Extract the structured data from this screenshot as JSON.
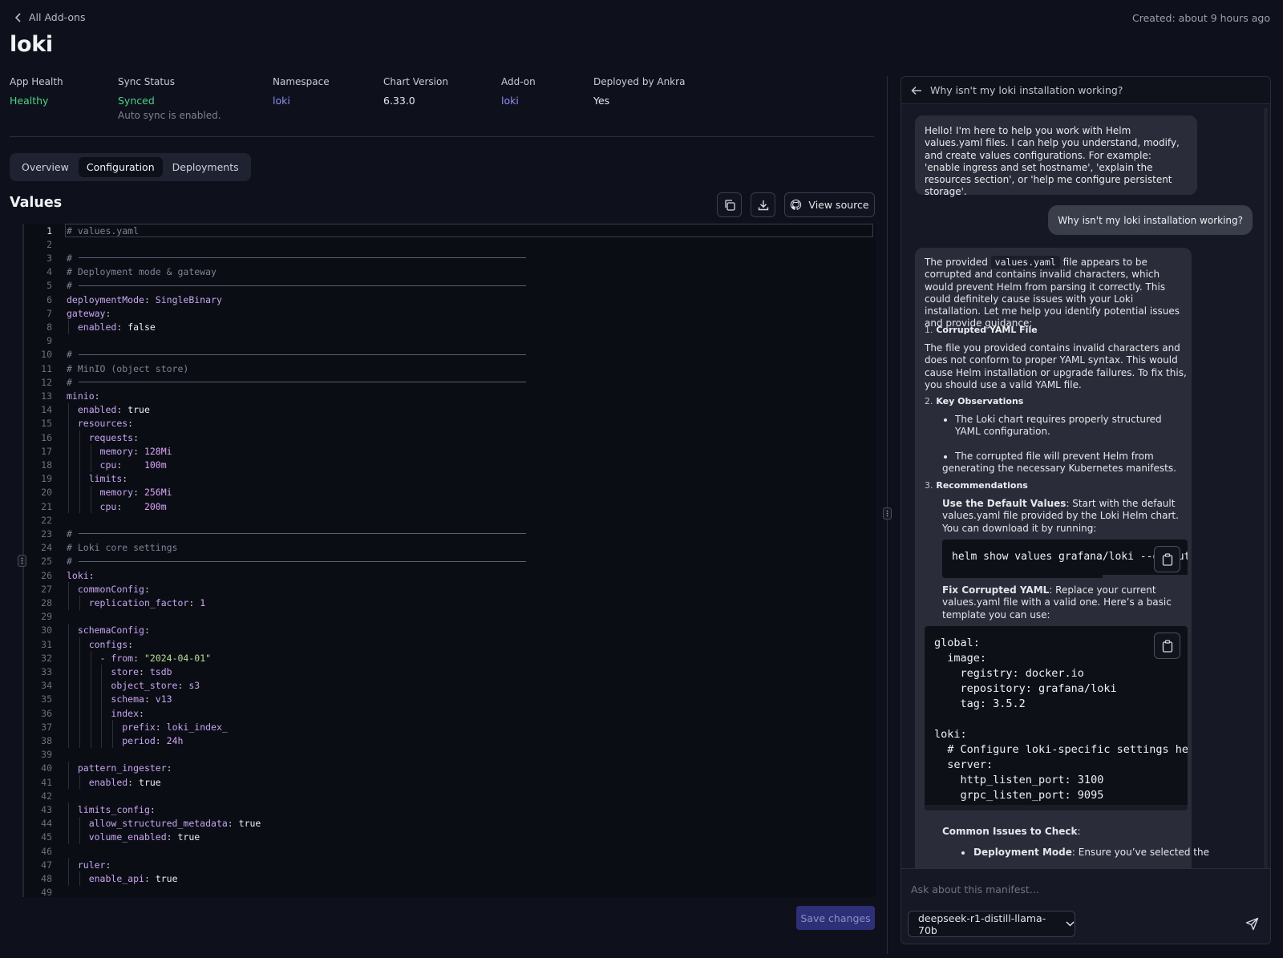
{
  "header": {
    "back_label": "All Add-ons",
    "created": "Created: about 9 hours ago",
    "title": "loki"
  },
  "meta": [
    {
      "label": "App Health",
      "value": "Healthy"
    },
    {
      "label": "Sync Status",
      "value": "Synced",
      "sub": "Auto sync is enabled."
    },
    {
      "label": "Namespace",
      "value": "loki"
    },
    {
      "label": "Chart Version",
      "value": "6.33.0"
    },
    {
      "label": "Add-on",
      "value": "loki"
    },
    {
      "label": "Deployed by Ankra",
      "value": "Yes"
    }
  ],
  "tabs": [
    "Overview",
    "Configuration",
    "Deployments"
  ],
  "active_tab": "Configuration",
  "values": {
    "title": "Values",
    "view_source": "View source",
    "save": "Save changes"
  },
  "code_lines": [
    "# values.yaml",
    "",
    "# ───────────────────────────────────────────────────────────",
    "# Deployment mode & gateway",
    "# ───────────────────────────────────────────────────────────",
    "deploymentMode: SingleBinary",
    "gateway:",
    "  enabled: false",
    "",
    "# ───────────────────────────────────────────────────────────",
    "# MinIO (object store)",
    "# ───────────────────────────────────────────────────────────",
    "minio:",
    "  enabled: true",
    "  resources:",
    "    requests:",
    "      memory: 128Mi",
    "      cpu:    100m",
    "    limits:",
    "      memory: 256Mi",
    "      cpu:    200m",
    "",
    "# ───────────────────────────────────────────────────────────",
    "# Loki core settings",
    "# ───────────────────────────────────────────────────────────",
    "loki:",
    "  commonConfig:",
    "    replication_factor: 1",
    "",
    "  schemaConfig:",
    "    configs:",
    "      - from: \"2024-04-01\"",
    "        store: tsdb",
    "        object_store: s3",
    "        schema: v13",
    "        index:",
    "          prefix: loki_index_",
    "          period: 24h",
    "",
    "  pattern_ingester:",
    "    enabled: true",
    "",
    "  limits_config:",
    "    allow_structured_metadata: true",
    "    volume_enabled: true",
    "",
    "  ruler:",
    "    enable_api: true",
    ""
  ],
  "chat": {
    "title": "Why isn't my loki installation working?",
    "greeting": "Hello! I'm here to help you work with Helm values.yaml files. I can help you understand, modify, and create values configurations. For example: 'enable ingress and set hostname', 'explain the resources section', or 'help me configure persistent storage'.",
    "user_message": "Why isn't my loki installation working?",
    "answer": {
      "intro_pre": "The provided",
      "intro_code": "values.yaml",
      "intro_post": "file appears to be corrupted and contains invalid characters, which would prevent Helm from parsing it correctly. This could definitely cause issues with your Loki installation. Let me help you identify potential issues and provide guidance:",
      "h1_num": "1.",
      "h1": "Corrupted YAML File",
      "p1": "The file you provided contains invalid characters and does not conform to proper YAML syntax. This would cause Helm installation or upgrade failures. To fix this, you should use a valid YAML file.",
      "h2_num": "2.",
      "h2": "Key Observations",
      "b1": "The Loki chart requires properly structured YAML configuration.",
      "b2": "The corrupted file will prevent Helm from generating the necessary Kubernetes manifests.",
      "h3_num": "3.",
      "h3": "Recommendations",
      "r1_bold": "Use the Default Values",
      "r1_text": ": Start with the default values.yaml file provided by the Loki Helm chart. You can download it by running:",
      "cmd": "helm show values grafana/loki --output",
      "r2_bold": "Fix Corrupted YAML",
      "r2_text": ": Replace your current values.yaml file with a valid one. Here’s a basic template you can use:",
      "template": "global:\n  image:\n    registry: docker.io\n    repository: grafana/loki\n    tag: 3.5.2\n\nloki:\n  # Configure loki-specific settings here\n  server:\n    http_listen_port: 3100\n    grpc_listen_port: 9095",
      "common_bold": "Common Issues to Check",
      "common_colon": ":",
      "dm_bold": "Deployment Mode",
      "dm_text": ": Ensure you’ve selected the"
    },
    "input_placeholder": "Ask about this manifest...",
    "model": "deepseek-r1-distill-llama-70b"
  },
  "colors": {
    "healthy": "#4fd08a",
    "link": "#8f8cf6",
    "save_button": "#2d2f77"
  }
}
